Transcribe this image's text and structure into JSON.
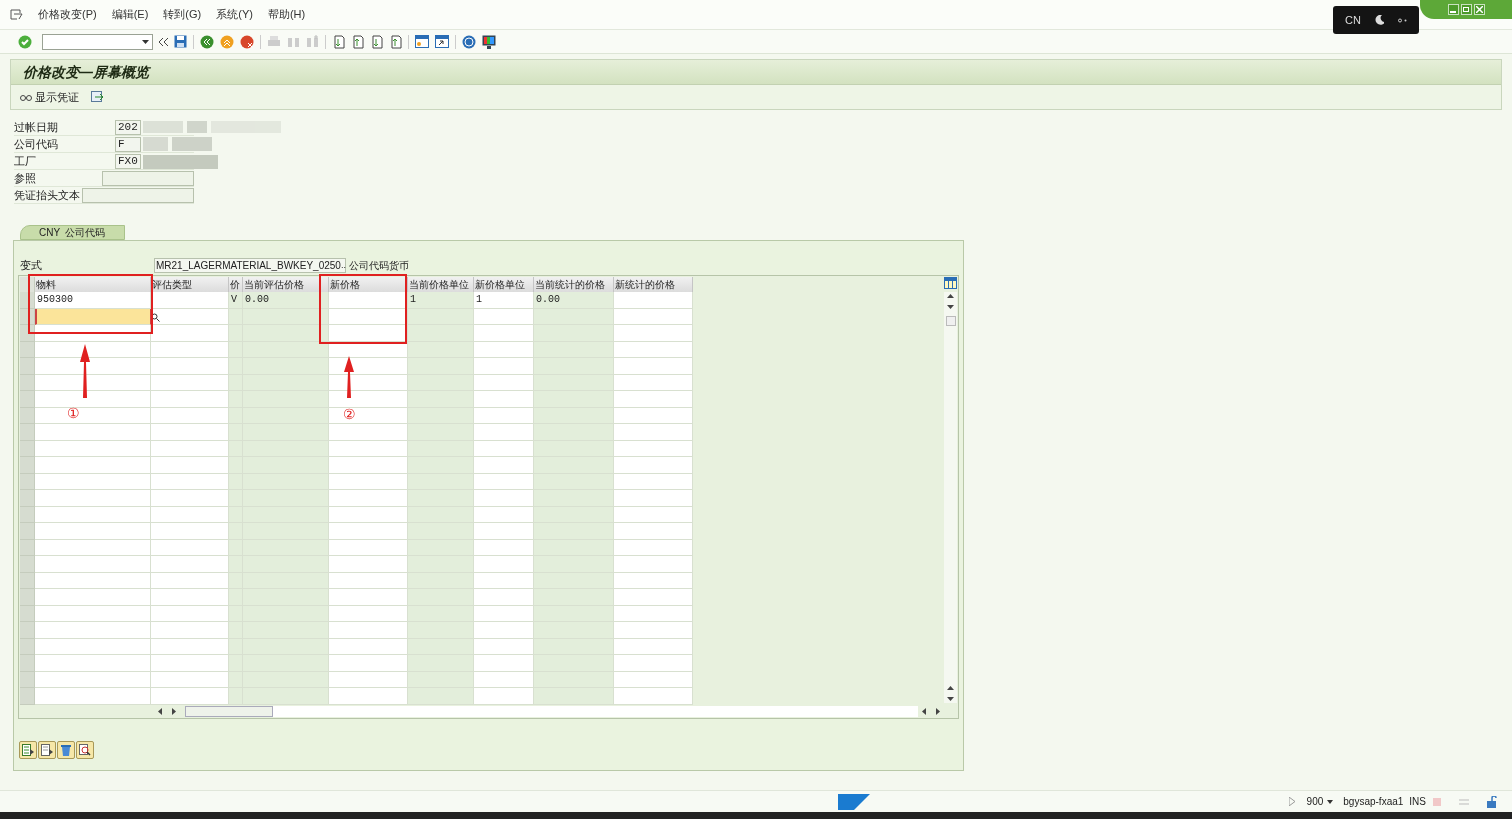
{
  "menu": [
    "价格改变(P)",
    "编辑(E)",
    "转到(G)",
    "系统(Y)",
    "帮助(H)"
  ],
  "language_badge": "CN",
  "screen_title": "价格改变—屏幕概览",
  "app_toolbar": [
    {
      "label": "显示凭证"
    }
  ],
  "header_fields": [
    {
      "label": "过帐日期",
      "value": "202"
    },
    {
      "label": "公司代码",
      "value": "F"
    },
    {
      "label": "工厂",
      "value": "FX0"
    },
    {
      "label": "参照"
    },
    {
      "label": "凭证抬头文本"
    }
  ],
  "tabs": [
    {
      "label": "CNY  公司代码",
      "selected": true
    }
  ],
  "layout": {
    "label": "变式",
    "value": "MR21_LAGERMATERIAL_BWKEY_0250",
    "more": "..",
    "currency": "公司代码货币"
  },
  "table": {
    "columns": [
      {
        "label": "物料",
        "editable": true
      },
      {
        "label": "评估类型",
        "editable": true
      },
      {
        "label": "价",
        "editable": false
      },
      {
        "label": "当前评估价格",
        "editable": false
      },
      {
        "label": "新价格",
        "editable": true
      },
      {
        "label": "当前价格单位",
        "editable": false
      },
      {
        "label": "新价格单位",
        "editable": true
      },
      {
        "label": "当前统计的价格",
        "editable": false
      },
      {
        "label": "新统计的价格",
        "editable": true
      }
    ],
    "rows": [
      {
        "cells": [
          "950300",
          "",
          "V",
          "0.00",
          "",
          "1",
          "1",
          "0.00",
          ""
        ]
      }
    ],
    "entry_row": {
      "focused": true
    }
  },
  "annotations": [
    {
      "label": "①"
    },
    {
      "label": "②"
    }
  ],
  "status_bar": {
    "client": "900",
    "server": "bgysap-fxaa1",
    "mode": "INS"
  }
}
